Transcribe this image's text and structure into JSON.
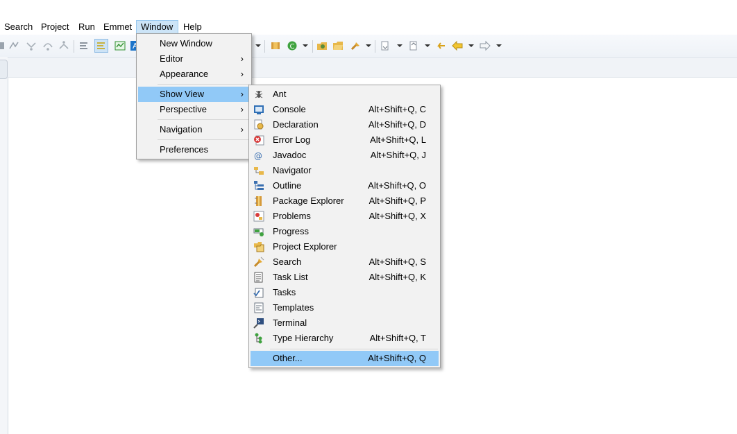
{
  "menubar": {
    "items": [
      {
        "label": "Search"
      },
      {
        "label": "Project"
      },
      {
        "label": "Run"
      },
      {
        "label": "Emmet"
      },
      {
        "label": "Window"
      },
      {
        "label": "Help"
      }
    ],
    "active": "Window"
  },
  "window_menu": {
    "items": [
      {
        "label": "New Window",
        "submenu": false
      },
      {
        "label": "Editor",
        "submenu": true
      },
      {
        "label": "Appearance",
        "submenu": true
      },
      {
        "label": "Show View",
        "submenu": true,
        "highlighted": true
      },
      {
        "label": "Perspective",
        "submenu": true
      },
      {
        "label": "Navigation",
        "submenu": true
      },
      {
        "label": "Preferences",
        "submenu": false
      }
    ],
    "arrow": "›"
  },
  "show_view_menu": {
    "items": [
      {
        "label": "Ant",
        "shortcut": "",
        "icon": "ant-icon"
      },
      {
        "label": "Console",
        "shortcut": "Alt+Shift+Q, C",
        "icon": "console-icon"
      },
      {
        "label": "Declaration",
        "shortcut": "Alt+Shift+Q, D",
        "icon": "declaration-icon"
      },
      {
        "label": "Error Log",
        "shortcut": "Alt+Shift+Q, L",
        "icon": "error-log-icon"
      },
      {
        "label": "Javadoc",
        "shortcut": "Alt+Shift+Q, J",
        "icon": "javadoc-icon"
      },
      {
        "label": "Navigator",
        "shortcut": "",
        "icon": "navigator-icon"
      },
      {
        "label": "Outline",
        "shortcut": "Alt+Shift+Q, O",
        "icon": "outline-icon"
      },
      {
        "label": "Package Explorer",
        "shortcut": "Alt+Shift+Q, P",
        "icon": "package-explorer-icon"
      },
      {
        "label": "Problems",
        "shortcut": "Alt+Shift+Q, X",
        "icon": "problems-icon"
      },
      {
        "label": "Progress",
        "shortcut": "",
        "icon": "progress-icon"
      },
      {
        "label": "Project Explorer",
        "shortcut": "",
        "icon": "project-explorer-icon"
      },
      {
        "label": "Search",
        "shortcut": "Alt+Shift+Q, S",
        "icon": "search-icon"
      },
      {
        "label": "Task List",
        "shortcut": "Alt+Shift+Q, K",
        "icon": "task-list-icon"
      },
      {
        "label": "Tasks",
        "shortcut": "",
        "icon": "tasks-icon"
      },
      {
        "label": "Templates",
        "shortcut": "",
        "icon": "templates-icon"
      },
      {
        "label": "Terminal",
        "shortcut": "",
        "icon": "terminal-icon"
      },
      {
        "label": "Type Hierarchy",
        "shortcut": "Alt+Shift+Q, T",
        "icon": "type-hierarchy-icon"
      },
      {
        "label": "Other...",
        "shortcut": "Alt+Shift+Q, Q",
        "icon": "",
        "highlighted": true
      }
    ]
  },
  "colors": {
    "menu_highlight": "#91c9f7",
    "menubar_active": "#cce4f7",
    "menu_background": "#f2f2f2"
  }
}
